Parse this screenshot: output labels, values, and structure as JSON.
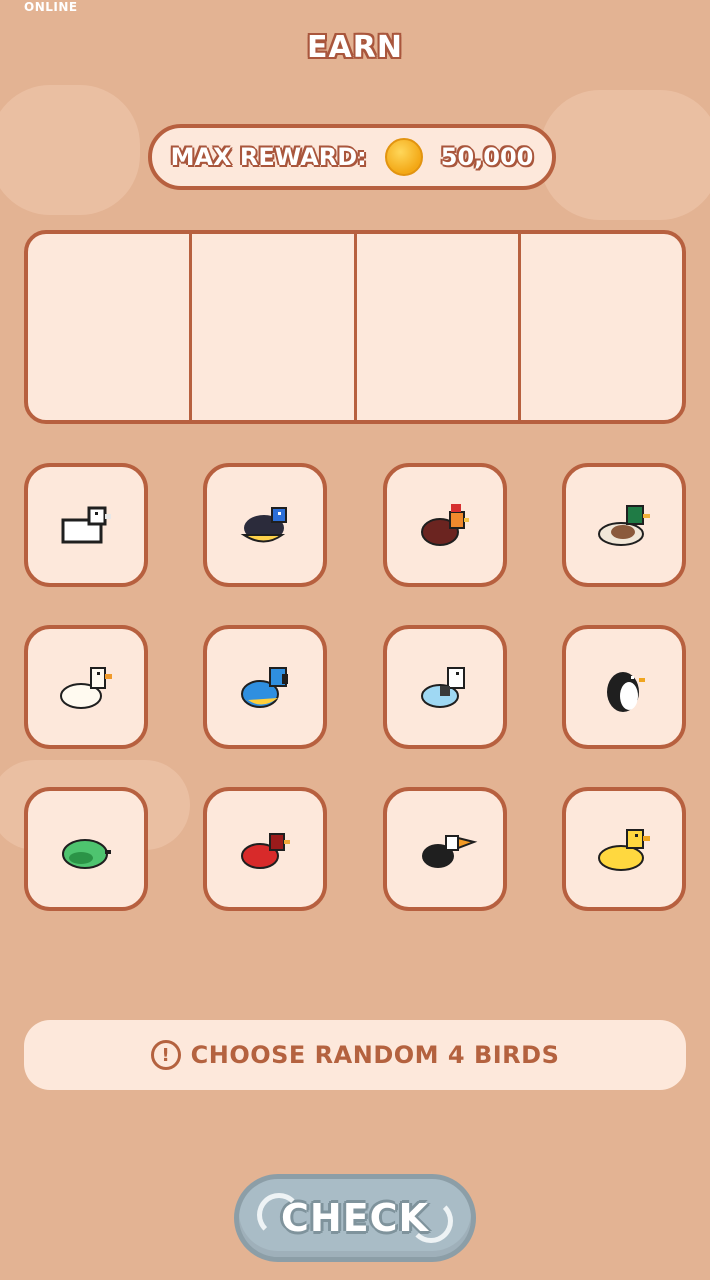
{
  "status": "ONLINE",
  "title": "EARN",
  "reward": {
    "label": "MAX REWARD:",
    "value": "50,000",
    "icon": "coin-icon"
  },
  "slots": 4,
  "birds": [
    {
      "name": "white-duck-icon",
      "colors": [
        "#ffffff",
        "#1f1f1f",
        "#e8e8e8"
      ]
    },
    {
      "name": "bluebird-icon",
      "colors": [
        "#2b2b3b",
        "#ffd24a",
        "#2c6fd8"
      ]
    },
    {
      "name": "rooster-icon",
      "colors": [
        "#6b2420",
        "#f0892d",
        "#d62f2f"
      ]
    },
    {
      "name": "mallard-duck-icon",
      "colors": [
        "#1f7b45",
        "#8b5a3c",
        "#f1e7d8"
      ]
    },
    {
      "name": "goose-icon",
      "colors": [
        "#fffaf0",
        "#1f1f1f",
        "#f09a2b"
      ]
    },
    {
      "name": "macaw-icon",
      "colors": [
        "#2f8fe0",
        "#ffcf3b",
        "#1f1f1f"
      ]
    },
    {
      "name": "budgie-icon",
      "colors": [
        "#9fd8f3",
        "#ffffff",
        "#3a3a3a"
      ]
    },
    {
      "name": "penguin-icon",
      "colors": [
        "#1f1f1f",
        "#ffffff",
        "#f0a51f"
      ]
    },
    {
      "name": "green-bird-icon",
      "colors": [
        "#4ec46f",
        "#2b9447",
        "#1f1f1f"
      ]
    },
    {
      "name": "cardinal-icon",
      "colors": [
        "#d82a2a",
        "#9b1b1b",
        "#f3a93a"
      ]
    },
    {
      "name": "toucan-icon",
      "colors": [
        "#1f1f1f",
        "#ffffff",
        "#f39a25"
      ]
    },
    {
      "name": "yellow-duck-icon",
      "colors": [
        "#ffd83f",
        "#f0a51f",
        "#1f1f1f"
      ]
    }
  ],
  "hint": {
    "icon": "exclamation-icon",
    "text": "CHOOSE RANDOM 4 BIRDS"
  },
  "check_button": {
    "label": "CHECK"
  }
}
